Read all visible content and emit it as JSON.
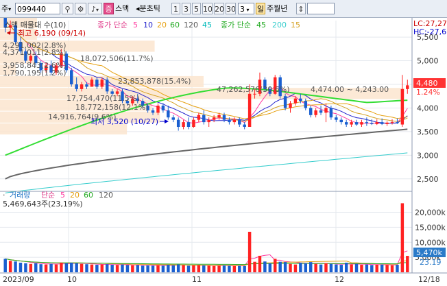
{
  "toolbar": {
    "market_label": "주",
    "code": "099440",
    "pink_button": "증",
    "stock_name": "스맥",
    "period_prefix": "◂분초틱",
    "period_options": [
      "1",
      "3",
      "5",
      "10",
      "20",
      "30"
    ],
    "count_value": "3",
    "active_period": "일",
    "periods_after": "주월년",
    "colors": {
      "accent_pink": "#e44a8a",
      "selected": "#ffe7a8"
    }
  },
  "price_panel": {
    "legend_title": "스맥 매물대 수(10)",
    "legend_ma1_label": "종가 단순",
    "legend_ma1_periods": [
      {
        "text": "5",
        "color": "#ff3ba0"
      },
      {
        "text": "10",
        "color": "#2222cc"
      },
      {
        "text": "20",
        "color": "#e6a010"
      },
      {
        "text": "60",
        "color": "#22aa22"
      },
      {
        "text": "120",
        "color": "#555555"
      },
      {
        "text": "45",
        "color": "#00bbbb"
      }
    ],
    "legend_ma2_label": "종가 단순",
    "legend_ma2_periods": [
      {
        "text": "45",
        "color": "#22aa22"
      },
      {
        "text": "200",
        "color": "#33cccc"
      },
      {
        "text": "15",
        "color": "#d4a020"
      }
    ],
    "top_right_lc": "LC:27,27",
    "top_right_hc": "HC:-27,6",
    "annotation_high": "최고 6,190 (09/14)",
    "annotation_low": "최저 3,520 (10/27)",
    "volume_profile_labels": [
      "4,291,002(2.8%)",
      "4,371,011(2.8%)",
      "18,072,506(11.7%)",
      "3,958,843(2.6%)",
      "1,790,195(1.2%)",
      "23,853,878(15.4%)",
      "47,262,576(30.6%)",
      "17,754,470(11.5%)",
      "18,772,158(12.1%)",
      "14,916,764(9.6%)"
    ],
    "range_label": "4,474.00 ~ 4,243.00",
    "current_price": "4,480",
    "current_change_pct": "1.24%",
    "y_ticks": [
      "5,500",
      "5,000",
      "4,500",
      "4,000",
      "3,500",
      "3,000",
      "2,500"
    ]
  },
  "volume_panel": {
    "legend_title": "거래량",
    "legend_ma_label": "단순",
    "legend_ma_periods": [
      {
        "text": "5",
        "color": "#ff3ba0"
      },
      {
        "text": "20",
        "color": "#e6a010"
      },
      {
        "text": "60",
        "color": "#22aa22"
      },
      {
        "text": "120",
        "color": "#555555"
      }
    ],
    "last_volume": "5,469,643주(23,19%)",
    "last_volume_box": "5,470k",
    "last_volume_pct": "23.19",
    "y_ticks": [
      "20,000k",
      "15,000k",
      "10,000k",
      "5,000k"
    ]
  },
  "x_axis": {
    "labels": [
      "2023/09",
      "10",
      "11",
      "12",
      "12/18"
    ]
  },
  "chart_data": {
    "type": "candlestick",
    "price_ylim": [
      2250,
      5850
    ],
    "volume_ylim": [
      0,
      24000
    ],
    "volume_unit": "k shares",
    "ohlc": [
      [
        5950,
        6190,
        5600,
        5700
      ],
      [
        5700,
        5850,
        5600,
        5750
      ],
      [
        5750,
        5800,
        5350,
        5400
      ],
      [
        5400,
        5500,
        5150,
        5200
      ],
      [
        5200,
        5250,
        4950,
        5000
      ],
      [
        5000,
        5150,
        4950,
        5100
      ],
      [
        5100,
        5200,
        4900,
        4950
      ],
      [
        4950,
        5000,
        4750,
        4800
      ],
      [
        4800,
        4950,
        4750,
        4900
      ],
      [
        4900,
        5000,
        4700,
        4750
      ],
      [
        4750,
        4950,
        4700,
        4900
      ],
      [
        4900,
        5250,
        4850,
        5150
      ],
      [
        5150,
        5200,
        4750,
        4800
      ],
      [
        4800,
        4850,
        4450,
        4500
      ],
      [
        4500,
        4650,
        4350,
        4400
      ],
      [
        4400,
        4550,
        4350,
        4500
      ],
      [
        4500,
        4550,
        4400,
        4450
      ],
      [
        4450,
        4650,
        4450,
        4600
      ],
      [
        4600,
        4650,
        4400,
        4450
      ],
      [
        4450,
        4650,
        4400,
        4600
      ],
      [
        4600,
        4650,
        4300,
        4350
      ],
      [
        4350,
        4400,
        4250,
        4300
      ],
      [
        4300,
        4400,
        4250,
        4350
      ],
      [
        4350,
        4400,
        4100,
        4150
      ],
      [
        4150,
        4200,
        4050,
        4100
      ],
      [
        4100,
        4250,
        4050,
        4200
      ],
      [
        4200,
        4300,
        4100,
        4150
      ],
      [
        4150,
        4200,
        4000,
        4050
      ],
      [
        4050,
        4100,
        3900,
        3950
      ],
      [
        3950,
        4000,
        3850,
        3900
      ],
      [
        3900,
        4100,
        3850,
        4050
      ],
      [
        4050,
        4100,
        3900,
        3950
      ],
      [
        3950,
        4050,
        3750,
        3800
      ],
      [
        3800,
        3850,
        3700,
        3750
      ],
      [
        3750,
        3800,
        3520,
        3600
      ],
      [
        3600,
        3750,
        3550,
        3700
      ],
      [
        3700,
        3800,
        3550,
        3600
      ],
      [
        3600,
        3800,
        3580,
        3750
      ],
      [
        3750,
        3900,
        3700,
        3850
      ],
      [
        3850,
        3950,
        3650,
        3700
      ],
      [
        3700,
        3800,
        3600,
        3750
      ],
      [
        3750,
        3850,
        3700,
        3800
      ],
      [
        3800,
        3900,
        3750,
        3850
      ],
      [
        3850,
        3900,
        3700,
        3750
      ],
      [
        3750,
        3800,
        3650,
        3700
      ],
      [
        3700,
        3800,
        3650,
        3750
      ],
      [
        3750,
        3800,
        3600,
        3650
      ],
      [
        3650,
        3700,
        3550,
        3600
      ],
      [
        3600,
        4500,
        3600,
        4300
      ],
      [
        4300,
        4400,
        4200,
        4300
      ],
      [
        4300,
        4750,
        4250,
        4600
      ],
      [
        4600,
        4650,
        4350,
        4400
      ],
      [
        4400,
        4450,
        4250,
        4300
      ],
      [
        4300,
        4700,
        4280,
        4650
      ],
      [
        4650,
        4700,
        4200,
        4250
      ],
      [
        4250,
        4300,
        3950,
        4000
      ],
      [
        4000,
        4150,
        3900,
        4100
      ],
      [
        4100,
        4250,
        4050,
        4200
      ],
      [
        4200,
        4300,
        4100,
        4150
      ],
      [
        4150,
        4200,
        3950,
        4000
      ],
      [
        4000,
        4050,
        3800,
        3850
      ],
      [
        3850,
        4000,
        3800,
        3950
      ],
      [
        3950,
        4050,
        3850,
        3900
      ],
      [
        3900,
        4100,
        3700,
        4000
      ],
      [
        4000,
        4050,
        3750,
        3800
      ],
      [
        3800,
        3850,
        3700,
        3750
      ],
      [
        3750,
        3800,
        3650,
        3700
      ],
      [
        3700,
        3750,
        3600,
        3650
      ],
      [
        3650,
        3750,
        3600,
        3700
      ],
      [
        3700,
        3750,
        3620,
        3650
      ],
      [
        3650,
        3750,
        3600,
        3700
      ],
      [
        3700,
        3800,
        3620,
        3680
      ],
      [
        3680,
        3760,
        3640,
        3660
      ],
      [
        3660,
        3760,
        3640,
        3700
      ],
      [
        3700,
        3780,
        3640,
        3660
      ],
      [
        3660,
        3720,
        3620,
        3690
      ],
      [
        3690,
        3760,
        3650,
        3700
      ],
      [
        3700,
        3780,
        3660,
        3680
      ],
      [
        3650,
        4700,
        3600,
        4400
      ],
      [
        4400,
        4600,
        4300,
        4480
      ]
    ],
    "volume": [
      4500,
      3800,
      3600,
      3200,
      3000,
      2800,
      3000,
      2700,
      2600,
      2800,
      2600,
      3200,
      3000,
      3200,
      3000,
      2800,
      2700,
      2600,
      2500,
      2600,
      2700,
      2500,
      2400,
      2600,
      2400,
      2300,
      2400,
      2200,
      2300,
      2200,
      2400,
      2200,
      2500,
      2300,
      2600,
      2400,
      2200,
      2300,
      2400,
      2300,
      2200,
      2100,
      2200,
      2300,
      2200,
      2100,
      2200,
      2100,
      13500,
      3500,
      5500,
      3600,
      3000,
      4500,
      3500,
      3400,
      2800,
      2600,
      3200,
      3000,
      3400,
      2800,
      2600,
      3000,
      2800,
      2600,
      2500,
      3200,
      2600,
      2800,
      2500,
      2600,
      2400,
      2500,
      2600,
      2400,
      2300,
      2500,
      23000,
      5470
    ],
    "volume_profile_pct": [
      2.8,
      2.8,
      11.7,
      2.6,
      1.2,
      15.4,
      30.6,
      11.5,
      12.1,
      9.6
    ]
  }
}
